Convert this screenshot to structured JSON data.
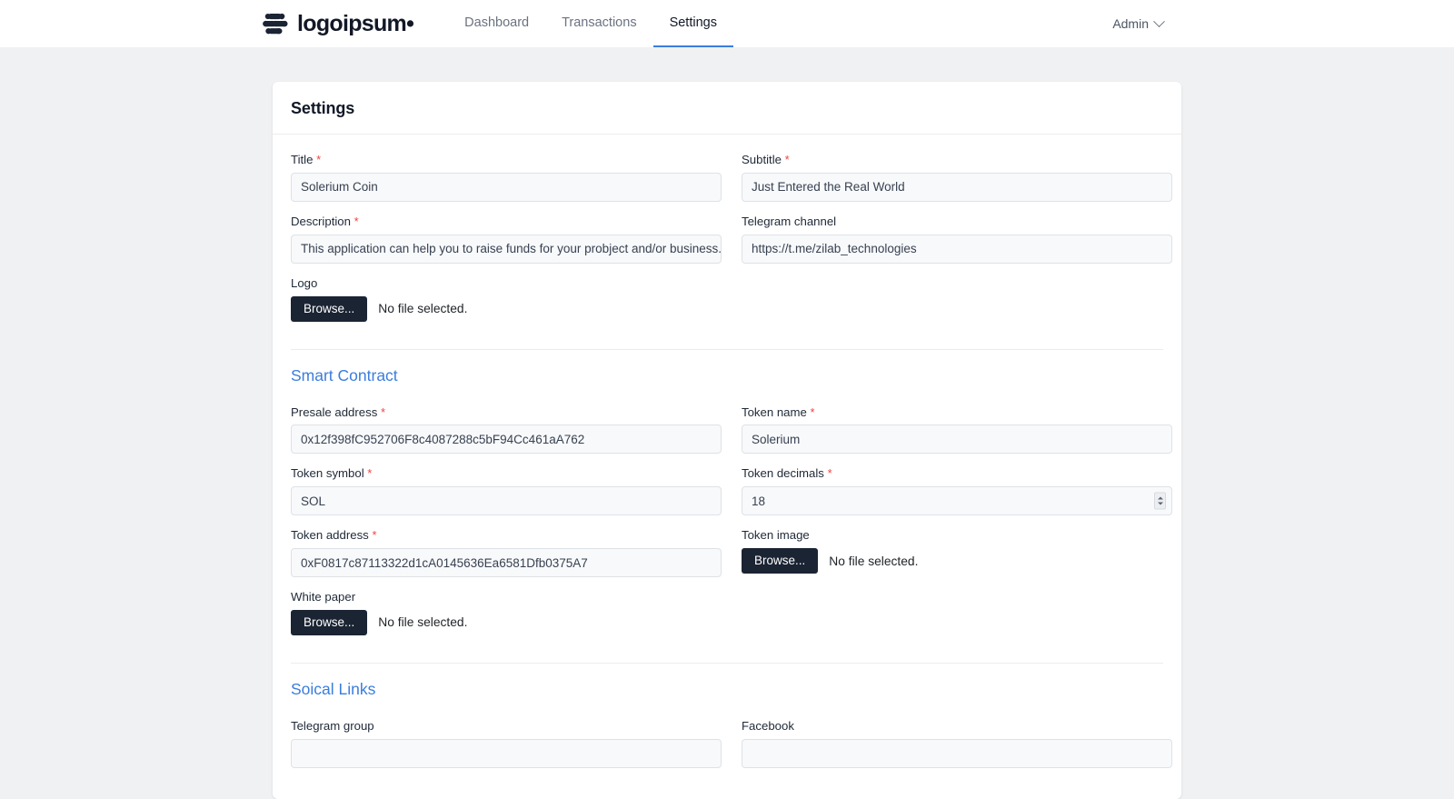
{
  "nav": {
    "brand": {
      "name": "logoipsum",
      "dot": "•",
      "mark_icon": "logoipsum-dots-mark"
    },
    "links": [
      {
        "label": "Dashboard",
        "active": false
      },
      {
        "label": "Transactions",
        "active": false
      },
      {
        "label": "Settings",
        "active": true
      }
    ],
    "account": {
      "label": "Admin",
      "icon": "chevron-down-icon"
    }
  },
  "card": {
    "title": "Settings"
  },
  "general": {
    "title": {
      "label": "Title",
      "required": "*",
      "value": "Solerium Coin"
    },
    "subtitle": {
      "label": "Subtitle",
      "required": "*",
      "value": "Just Entered the Real World"
    },
    "description": {
      "label": "Description",
      "required": "*",
      "value": "This application can help you to raise funds for your probject and/or business. You can"
    },
    "telegram_channel": {
      "label": "Telegram channel",
      "value": "https://t.me/zilab_technologies"
    },
    "logo": {
      "label": "Logo",
      "browse_label": "Browse...",
      "status": "No file selected."
    }
  },
  "smart_contract": {
    "section_title": "Smart Contract",
    "presale_address": {
      "label": "Presale address",
      "required": "*",
      "value": "0x12f398fC952706F8c4087288c5bF94Cc461aA762"
    },
    "token_name": {
      "label": "Token name",
      "required": "*",
      "value": "Solerium"
    },
    "token_symbol": {
      "label": "Token symbol",
      "required": "*",
      "value": "SOL"
    },
    "token_decimals": {
      "label": "Token decimals",
      "required": "*",
      "value": "18",
      "stepper_icon": "number-stepper-icon"
    },
    "token_address": {
      "label": "Token address",
      "required": "*",
      "value": "0xF0817c87113322d1cA0145636Ea6581Dfb0375A7"
    },
    "token_image": {
      "label": "Token image",
      "browse_label": "Browse...",
      "status": "No file selected."
    },
    "white_paper": {
      "label": "White paper",
      "browse_label": "Browse...",
      "status": "No file selected."
    }
  },
  "social_links": {
    "section_title": "Soical Links",
    "telegram_group": {
      "label": "Telegram group",
      "value": ""
    },
    "facebook": {
      "label": "Facebook",
      "value": ""
    }
  },
  "colors": {
    "accent": "#3b7ddd",
    "required": "#ef4444",
    "dark_button": "#1b2433",
    "page_bg": "#f0f1f3"
  }
}
